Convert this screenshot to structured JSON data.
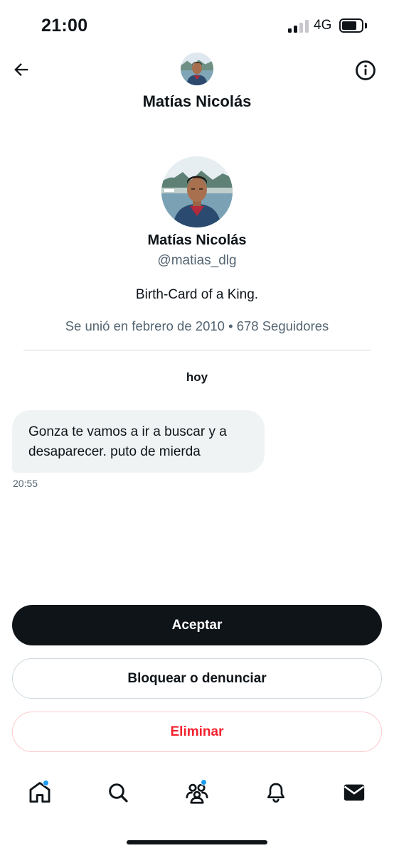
{
  "status_bar": {
    "time": "21:00",
    "network": "4G",
    "signal_level_bars": 2,
    "battery_level": 0.65
  },
  "header": {
    "title": "Matías Nicolás",
    "back_icon": "arrow-left-icon",
    "info_icon": "info-circle-icon"
  },
  "profile": {
    "name": "Matías Nicolás",
    "handle": "@matias_dlg",
    "bio": "Birth-Card of a King.",
    "meta": "Se unió en febrero de 2010 • 678 Seguidores"
  },
  "conversation": {
    "date_label": "hoy",
    "messages": [
      {
        "text": "Gonza te vamos a ir a buscar y a desaparecer. puto de mierda",
        "time": "20:55"
      }
    ]
  },
  "actions": {
    "accept_label": "Aceptar",
    "block_label": "Bloquear o denunciar",
    "delete_label": "Eliminar"
  },
  "nav": {
    "items": [
      {
        "icon": "home-icon",
        "has_dot": true
      },
      {
        "icon": "search-icon",
        "has_dot": false
      },
      {
        "icon": "communities-icon",
        "has_dot": true
      },
      {
        "icon": "bell-icon",
        "has_dot": false
      },
      {
        "icon": "mail-icon",
        "has_dot": false
      }
    ]
  },
  "colors": {
    "text_primary": "#0f1419",
    "text_secondary": "#536471",
    "accent_blue": "#1d9bf0",
    "danger_red": "#f4212e",
    "bubble_bg": "#eff3f4"
  }
}
